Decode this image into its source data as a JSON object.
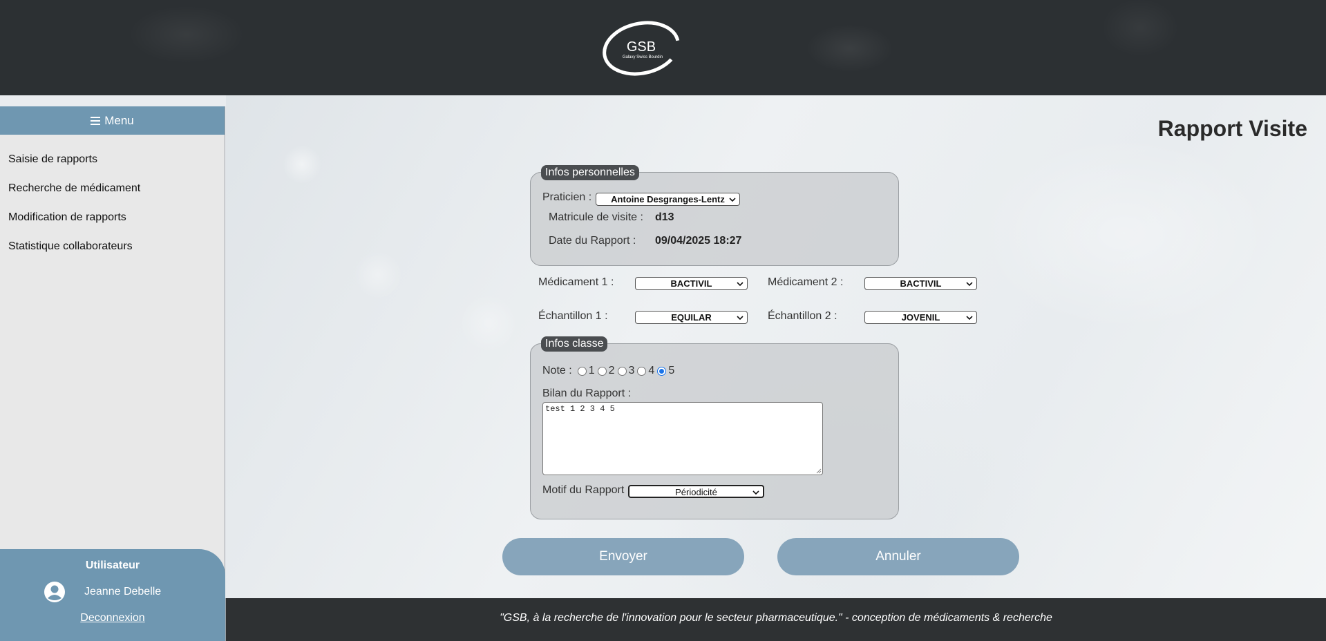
{
  "header": {
    "logo_text": "GSB",
    "logo_subtext": "Galaxy Swiss Bourdin"
  },
  "sidebar": {
    "menu_label": "Menu",
    "items": [
      {
        "label": "Saisie de rapports"
      },
      {
        "label": "Recherche de médicament"
      },
      {
        "label": "Modification de rapports"
      },
      {
        "label": "Statistique collaborateurs"
      }
    ],
    "user": {
      "title": "Utilisateur",
      "name": "Jeanne Debelle",
      "logout_label": "Deconnexion"
    }
  },
  "main": {
    "title": "Rapport Visite",
    "perso": {
      "legend": "Infos personnelles",
      "praticien_label": "Praticien :",
      "praticien_value": "Antoine Desgranges-Lentz",
      "matricule_label": "Matricule de visite :",
      "matricule_value": "d13",
      "date_label": "Date du Rapport :",
      "date_value": "09/04/2025 18:27"
    },
    "med1_label": "Médicament 1 :",
    "med1_value": "BACTIVIL",
    "med2_label": "Médicament 2 :",
    "med2_value": "BACTIVIL",
    "ech1_label": "Échantillon 1 :",
    "ech1_value": "EQUILAR",
    "ech2_label": "Échantillon 2 :",
    "ech2_value": "JOVENIL",
    "classe": {
      "legend": "Infos classe",
      "note_label": "Note :",
      "notes": [
        "1",
        "2",
        "3",
        "4",
        "5"
      ],
      "note_selected": "5",
      "bilan_label": "Bilan du Rapport :",
      "bilan_value": "test 1 2 3 4 5",
      "motif_label": "Motif du Rapport",
      "motif_value": "Périodicité"
    },
    "send_label": "Envoyer",
    "cancel_label": "Annuler"
  },
  "footer": {
    "text": "\"GSB, à la recherche de l'innovation pour le secteur pharmaceutique.\" - conception de médicaments & recherche"
  },
  "colors": {
    "accent": "#6f97b1",
    "button": "#87a5bb",
    "header": "#2c3033",
    "radio_selected": "#1a73e8"
  }
}
